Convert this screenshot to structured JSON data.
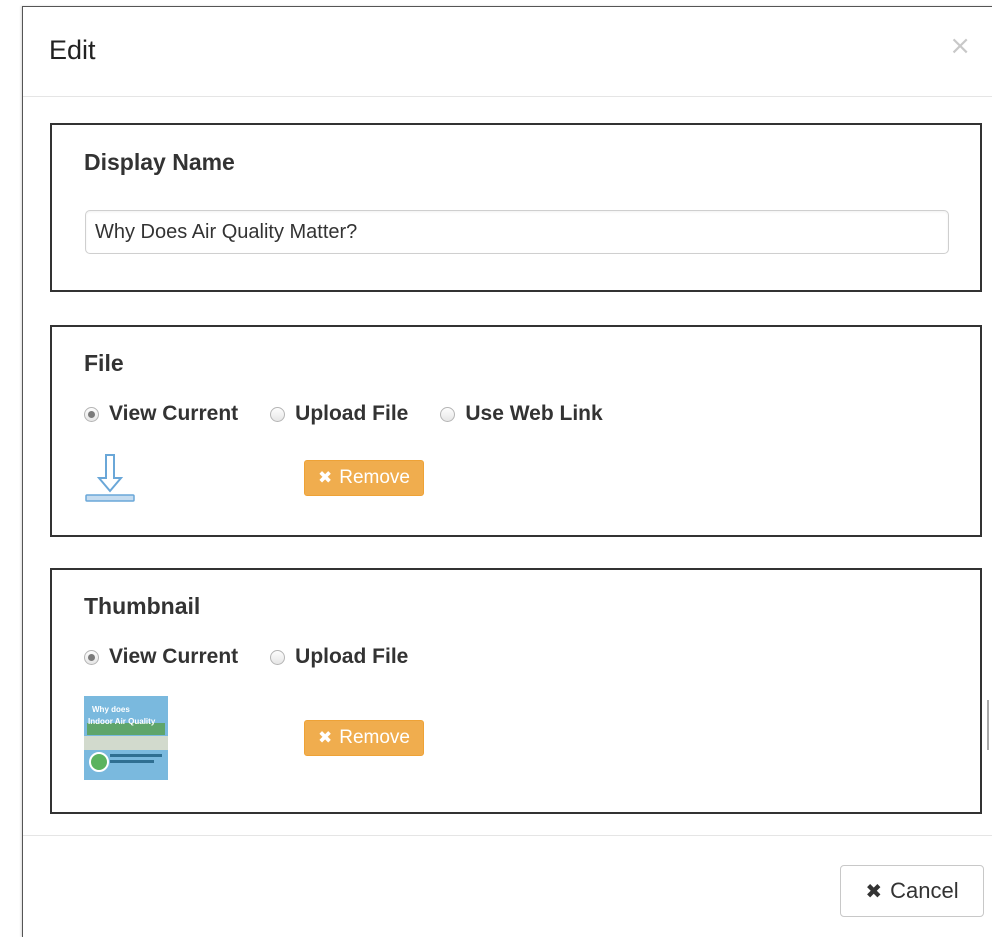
{
  "dialog": {
    "title": "Edit",
    "close_glyph": "×",
    "close_icon": "close-icon"
  },
  "display_name": {
    "heading": "Display Name",
    "value": "Why Does Air Quality Matter?"
  },
  "file": {
    "heading": "File",
    "options": [
      "View Current",
      "Upload File",
      "Use Web Link"
    ],
    "selected": "View Current",
    "download_icon": "download-icon",
    "remove_label": "Remove",
    "remove_glyph": "✖"
  },
  "thumbnail": {
    "heading": "Thumbnail",
    "options": [
      "View Current",
      "Upload File"
    ],
    "selected": "View Current",
    "image_text_1": "Why does",
    "image_text_2": "Indoor Air Quality",
    "remove_label": "Remove",
    "remove_glyph": "✖"
  },
  "footer": {
    "cancel_label": "Cancel",
    "cancel_glyph": "✖"
  },
  "colors": {
    "warning": "#f0ad4e",
    "border": "#333333",
    "download_icon": "#6aa7d8"
  }
}
